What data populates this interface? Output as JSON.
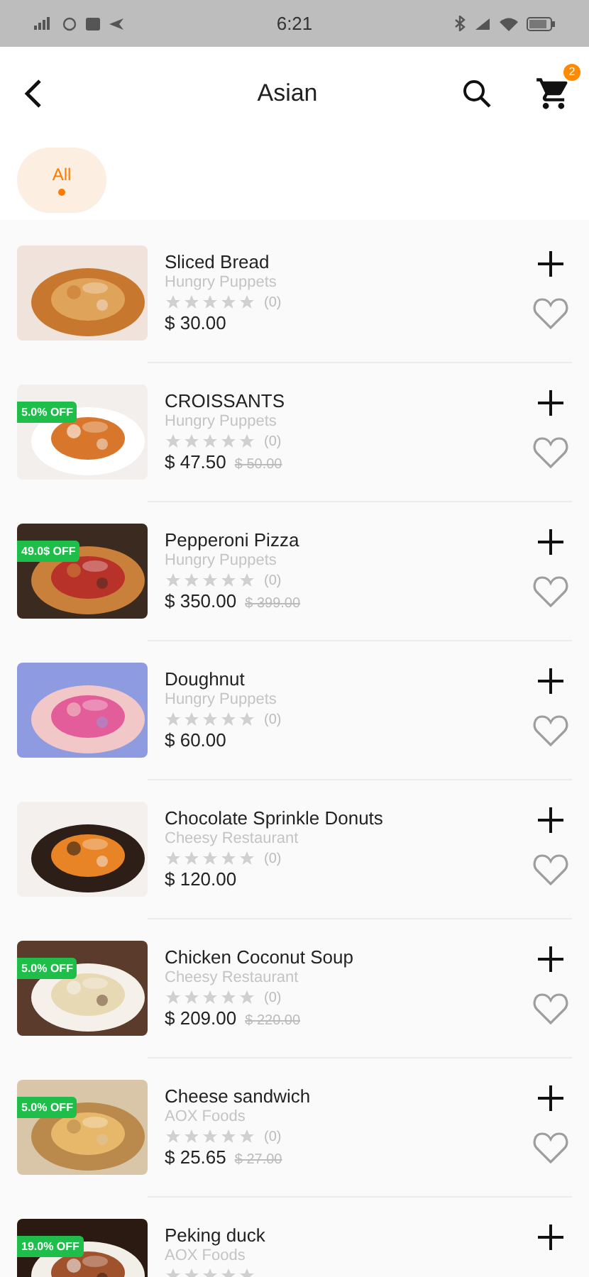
{
  "status_bar": {
    "time": "6:21"
  },
  "header": {
    "title": "Asian",
    "cart_count": "2"
  },
  "filters": [
    {
      "label": "All",
      "selected": true
    }
  ],
  "products": [
    {
      "name": "Sliced Bread",
      "restaurant": "Hungry Puppets",
      "stars": 0,
      "rating_count": "(0)",
      "price": "$ 30.00"
    },
    {
      "name": "CROISSANTS",
      "restaurant": "Hungry Puppets",
      "stars": 0,
      "rating_count": "(0)",
      "price": "$ 47.50",
      "old_price": "$ 50.00",
      "discount": "5.0% OFF"
    },
    {
      "name": "Pepperoni Pizza",
      "restaurant": "Hungry Puppets",
      "stars": 0,
      "rating_count": "(0)",
      "price": "$ 350.00",
      "old_price": "$ 399.00",
      "discount": "49.0$ OFF"
    },
    {
      "name": "Doughnut",
      "restaurant": "Hungry Puppets",
      "stars": 0,
      "rating_count": "(0)",
      "price": "$ 60.00"
    },
    {
      "name": "Chocolate Sprinkle Donuts",
      "restaurant": "Cheesy Restaurant",
      "stars": 0,
      "rating_count": "(0)",
      "price": "$ 120.00"
    },
    {
      "name": "Chicken Coconut Soup",
      "restaurant": "Cheesy Restaurant",
      "stars": 0,
      "rating_count": "(0)",
      "price": "$ 209.00",
      "old_price": "$ 220.00",
      "discount": "5.0% OFF"
    },
    {
      "name": "Cheese sandwich",
      "restaurant": "AOX Foods",
      "stars": 0,
      "rating_count": "(0)",
      "price": "$ 25.65",
      "old_price": "$ 27.00",
      "discount": "5.0% OFF"
    },
    {
      "name": "Peking duck",
      "restaurant": "AOX Foods",
      "stars": 0,
      "discount": "19.0% OFF"
    }
  ]
}
